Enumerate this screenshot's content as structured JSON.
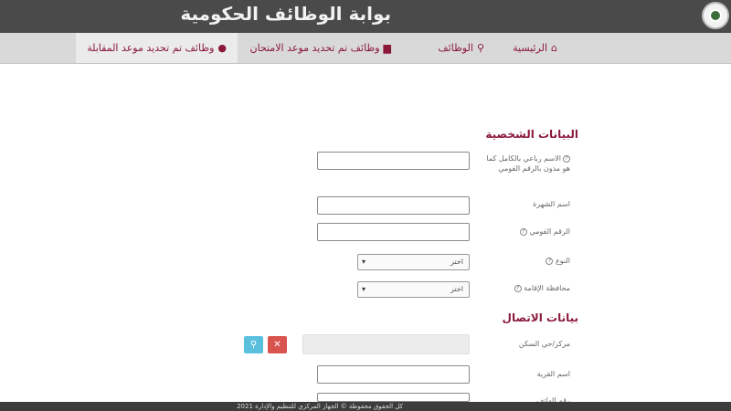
{
  "header": {
    "site_title": "بوابة الوظائف الحكومية",
    "logo_icon": "emblem-logo"
  },
  "nav": {
    "items": [
      {
        "label": "الرئيسية",
        "icon": "home-icon"
      },
      {
        "label": "الوظائف",
        "icon": "search-icon"
      },
      {
        "label": "وظائف تم تحديد موعد الامتحان",
        "icon": "document-icon"
      },
      {
        "label": "وظائف تم تحديد موعد المقابلة",
        "icon": "user-icon"
      }
    ]
  },
  "personal": {
    "title": "البيانات الشخصية",
    "full_name_label": "الاسم رباعي بالكامل كما هو مدون بالرقم القومي",
    "family_name_label": "اسم الشهرة",
    "national_id_label": "الرقم القومي",
    "gender_label": "النوع",
    "gender_value": "اختر",
    "governorate_label": "محافظة الإقامة",
    "governorate_value": "اختر"
  },
  "contact": {
    "title": "بيانات الاتصال",
    "center_label": "مركز/حي السكن",
    "village_label": "اسم القرية",
    "phone_label": "رقم الهاتف"
  },
  "footer": {
    "text": "كل الحقوق محفوظة © الجهاز المركزي للتنظيم والإدارة 2021"
  },
  "colors": {
    "accent": "#8b1a3a",
    "topbar": "#4a4a4a",
    "navbar": "#d9d9d9"
  }
}
